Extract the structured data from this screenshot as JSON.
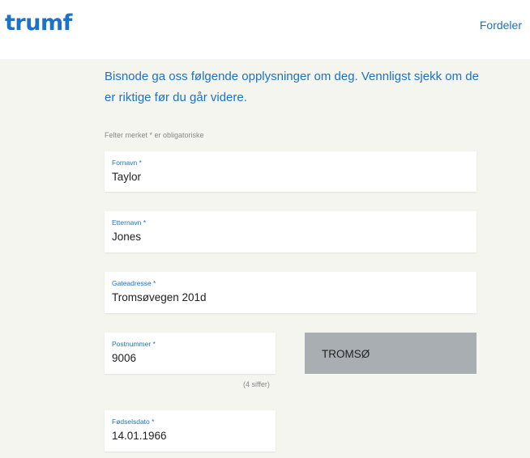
{
  "header": {
    "logo_text": "trumf",
    "nav_link": "Fordeler",
    "brand_color": "#1b72c6"
  },
  "intro": {
    "text": "Bisnode ga oss følgende opplysninger om deg. Vennligst sjekk om de er riktige før du går videre."
  },
  "form": {
    "required_note": "Felter merket * er obligatoriske",
    "first_name": {
      "label": "Fornavn *",
      "value": "Taylor"
    },
    "last_name": {
      "label": "Etternavn *",
      "value": "Jones"
    },
    "street": {
      "label": "Gateadresse *",
      "value": "Tromsøvegen 201d"
    },
    "postal_code": {
      "label": "Postnummer *",
      "value": "9006",
      "hint": "(4 siffer)"
    },
    "city": {
      "value": "TROMSØ"
    },
    "birth_date": {
      "label": "Fødselsdato *",
      "value": "14.01.1966"
    }
  }
}
